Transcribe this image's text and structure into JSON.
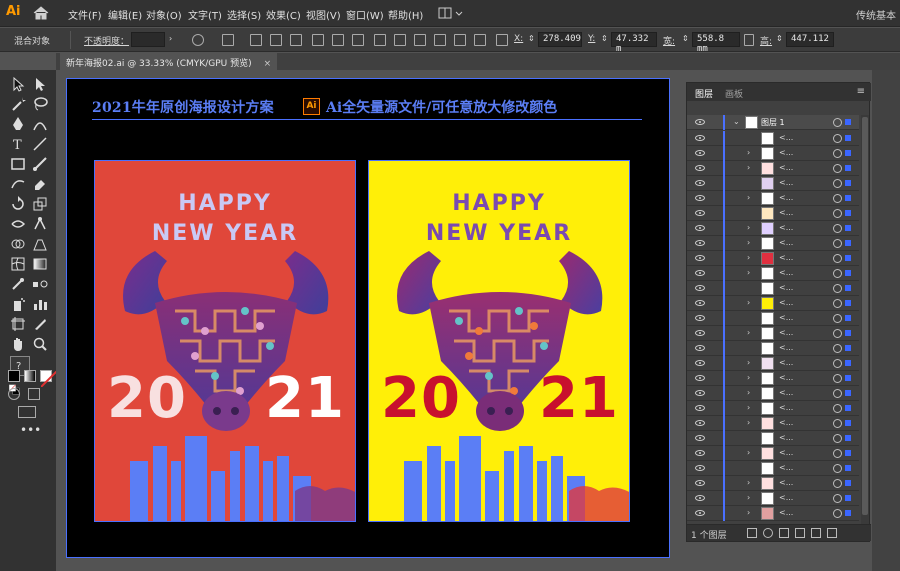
{
  "app": {
    "logo": "Ai",
    "workspace": "传统基本"
  },
  "menu": [
    "文件(F)",
    "编辑(E)",
    "对象(O)",
    "文字(T)",
    "选择(S)",
    "效果(C)",
    "视图(V)",
    "窗口(W)",
    "帮助(H)"
  ],
  "control_bar": {
    "blend_label": "混合对象",
    "opacity_label": "不透明度：",
    "x_label": "X:",
    "x_value": "278.409",
    "y_label": "Y:",
    "y_value": "47.332 m",
    "w_label": "宽:",
    "w_value": "558.8 mm",
    "h_label": "高:",
    "h_value": "447.112"
  },
  "document_tab": {
    "title": "新年海报02.ai @ 33.33% (CMYK/GPU 预览)",
    "close": "×"
  },
  "document": {
    "heading": "2021牛年原创海报设计方案",
    "ai_badge": "Ai",
    "heading2": "Ai全矢量源文件/可任意放大修改颜色",
    "poster_red": {
      "line1": "HAPPY",
      "line2": "NEW YEAR",
      "year_left": "20",
      "year_right": "21"
    },
    "poster_yellow": {
      "line1": "HAPPY",
      "line2": "NEW YEAR",
      "year_left": "20",
      "year_right": "21"
    }
  },
  "layers_panel": {
    "tab_active": "图层",
    "tab_inactive": "画板",
    "top_layer": "图层 1",
    "item_label": "<...",
    "layer_count": "1 个图层"
  },
  "colors": {
    "accent": "#4a70ff",
    "panel_bg": "#404040",
    "red_poster": "#e0473a",
    "yellow_poster": "#ffef08"
  }
}
